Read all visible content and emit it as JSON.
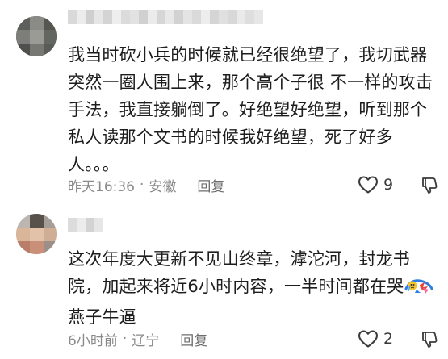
{
  "comments": [
    {
      "text": "我当时砍小兵的时候就已经很绝望了，我切武器突然一圈人围上来，那个高个子很 不一样的攻击手法，我直接躺倒了。好绝望好绝望，听到那个私人读那个文书的时候我好绝望，死了好多人。。。",
      "time": "昨天16:36",
      "location": "安徽",
      "reply_label": "回复",
      "likes": "9"
    },
    {
      "text_before_emoji": "这次年度大更新不见山终章，滹沱河，封龙书院，加起来将近6小时内容，一半时间都在哭",
      "text_after_emoji": "燕子牛逼",
      "time": "6小时前",
      "location": "辽宁",
      "reply_label": "回复",
      "likes": "2"
    }
  ],
  "separator": "·",
  "colors": {
    "text": "#1d1d1d",
    "meta": "#8a8a8a"
  },
  "icons": [
    "avatar-pixelated",
    "heart-outline-icon",
    "thumbs-down-outline-icon",
    "crying-emoji-icon"
  ]
}
